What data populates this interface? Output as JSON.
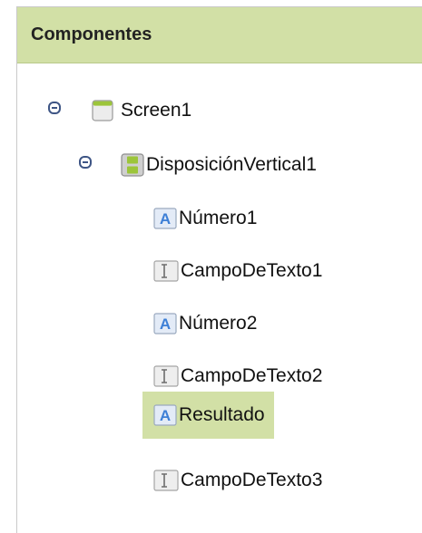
{
  "panel": {
    "title": "Componentes"
  },
  "tree": {
    "screen": {
      "label": "Screen1",
      "icon": "screen-icon",
      "expanded": true
    },
    "arrangement": {
      "label": "DisposiciónVertical1",
      "icon": "vertical-arrangement-icon",
      "expanded": true
    },
    "items": [
      {
        "label": "Número1",
        "icon": "label-icon",
        "selected": false
      },
      {
        "label": "CampoDeTexto1",
        "icon": "textbox-icon",
        "selected": false
      },
      {
        "label": "Número2",
        "icon": "label-icon",
        "selected": false
      },
      {
        "label": "CampoDeTexto2",
        "icon": "textbox-icon",
        "selected": false
      },
      {
        "label": "Resultado",
        "icon": "label-icon",
        "selected": true
      },
      {
        "label": "CampoDeTexto3",
        "icon": "textbox-icon",
        "selected": false
      }
    ]
  },
  "colors": {
    "header": "#d2e0a6",
    "selection": "#d2e0a6",
    "toggle": "#3e5585",
    "label_icon": "#3d7fd6"
  }
}
